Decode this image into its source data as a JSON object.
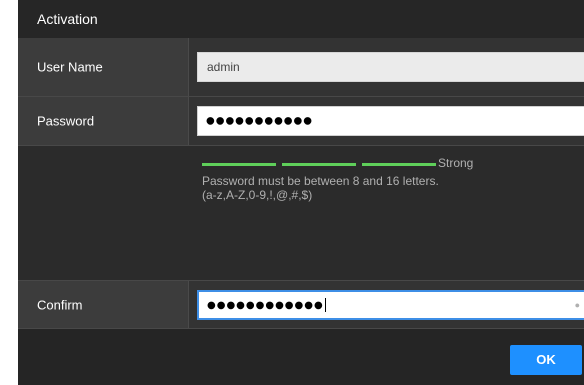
{
  "dialog": {
    "title": "Activation"
  },
  "fields": {
    "username": {
      "label": "User Name",
      "value": "admin"
    },
    "password": {
      "label": "Password",
      "value": "●●●●●●●●●●●"
    },
    "confirm": {
      "label": "Confirm",
      "value": "●●●●●●●●●●●●"
    }
  },
  "strength": {
    "label": "Strong",
    "level_bars_filled": 3,
    "level_bars_total": 3,
    "color": "#5fcf5a",
    "hint_line1": "Password must be between 8 and 16 letters.",
    "hint_line2": "(a-z,A-Z,0-9,!,@,#,$)"
  },
  "footer": {
    "ok_label": "OK"
  },
  "colors": {
    "accent": "#1e90ff",
    "background": "#2b2b2b",
    "label_cell": "#3c3c3c"
  }
}
